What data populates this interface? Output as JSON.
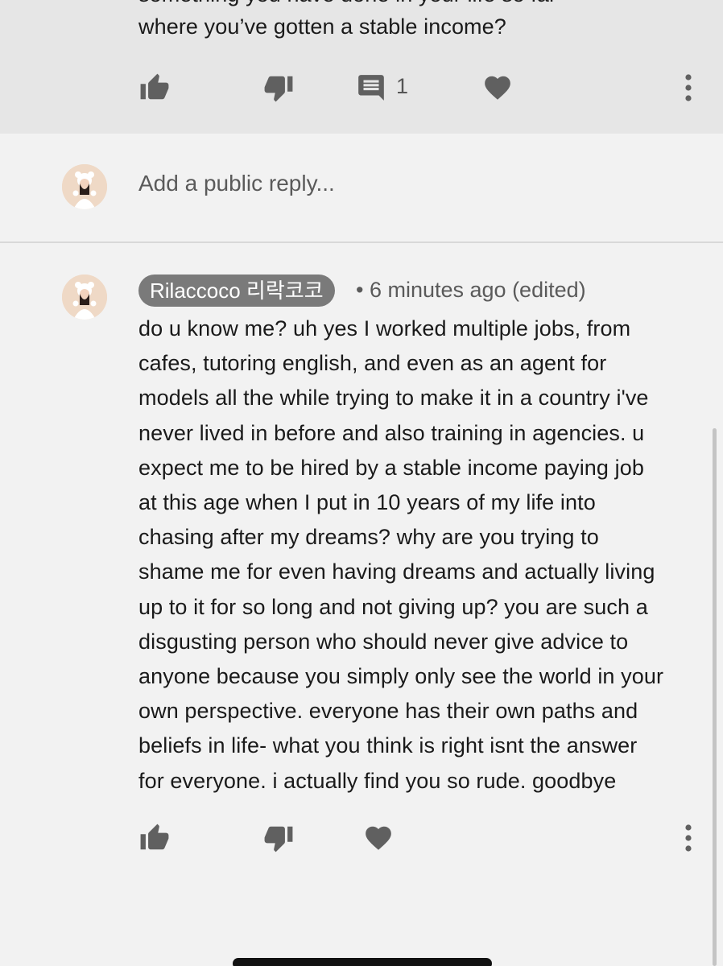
{
  "parent_comment": {
    "partial_line": "something you have done in your life so far",
    "text_line": "where you’ve gotten a stable income?",
    "reply_count": "1"
  },
  "reply_box": {
    "placeholder": "Add a public reply..."
  },
  "comment": {
    "author": "Rilaccoco 리락코코",
    "meta": "• 6 minutes ago (edited)",
    "lines": [
      "do u know me? uh yes I worked multiple jobs, from",
      "cafes, tutoring english, and even as an agent for",
      "models all the while trying to make it in a country i've",
      "never lived in before and also training in agencies. u",
      "expect me to be hired by a stable income paying job",
      "at this age when I put in 10 years of my life into",
      "chasing after my dreams? why are you trying to",
      "shame me for even having dreams and actually living",
      "up to it for so long and not giving up? you are such a",
      "disgusting person who should never give advice to",
      "anyone because you simply only see the world in your",
      "own perspective. everyone has their own paths and",
      "beliefs in life- what you think is right isnt the answer",
      "for everyone. i actually find you so rude. goodbye"
    ]
  },
  "icons": {
    "like": "thumbs-up-icon",
    "dislike": "thumbs-down-icon",
    "reply": "comment-icon",
    "heart": "heart-icon",
    "more": "more-vertical-icon"
  },
  "colors": {
    "background": "#f2f2f2",
    "parent_background": "#e6e6e6",
    "icon": "#606060",
    "author_chip": "#7a7a7a"
  }
}
